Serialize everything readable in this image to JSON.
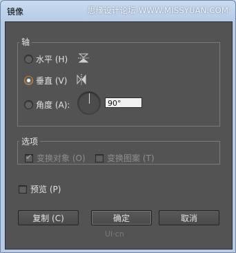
{
  "window": {
    "title": "镜像",
    "watermark": "思缘设计论坛 WWW.MISSYUAN.COM"
  },
  "axis_group": {
    "title": "轴",
    "horizontal_label": "水平 (H)",
    "vertical_label": "垂直 (V)",
    "angle_label": "角度 (A):",
    "angle_value": "90°",
    "selected": "vertical"
  },
  "options_group": {
    "title": "选项",
    "transform_objects_label": "变换对象 (O)",
    "transform_objects_checked": true,
    "transform_patterns_label": "变换图案 (T)",
    "transform_patterns_checked": false
  },
  "preview": {
    "label": "预览 (P)",
    "checked": false
  },
  "buttons": {
    "copy": "复制 (C)",
    "ok": "确定",
    "cancel": "取消"
  },
  "logo": {
    "text": "UI·cn"
  },
  "icons": [
    "horizontal-mirror-icon",
    "vertical-mirror-icon",
    "angle-dial-icon"
  ]
}
